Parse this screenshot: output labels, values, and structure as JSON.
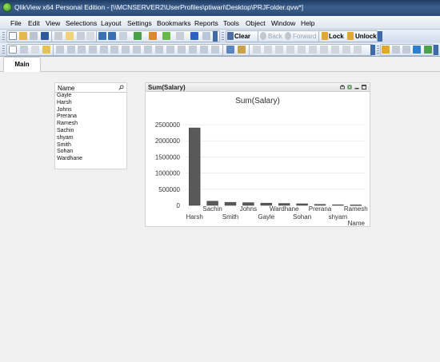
{
  "window": {
    "title": "QlikView x64 Personal Edition - [\\\\MCNSERVER2\\UserProfiles\\ptiwari\\Desktop\\PRJFolder.qvw*]"
  },
  "menu": [
    "File",
    "Edit",
    "View",
    "Selections",
    "Layout",
    "Settings",
    "Bookmarks",
    "Reports",
    "Tools",
    "Object",
    "Window",
    "Help"
  ],
  "toolbar": {
    "clear": "Clear",
    "back": "Back",
    "forward": "Forward",
    "lock": "Lock",
    "unlock": "Unlock"
  },
  "tabs": [
    {
      "label": "Main"
    }
  ],
  "listbox": {
    "title": "Name",
    "items": [
      "Gayle",
      "Harsh",
      "Johns",
      "Prerana",
      "Ramesh",
      "Sachin",
      "shyam",
      "Smith",
      "Sohan",
      "Wardhane"
    ]
  },
  "chartbox": {
    "caption": "Sum(Salary)",
    "chart_data": {
      "type": "bar",
      "title": "Sum(Salary)",
      "xlabel": "Name",
      "ylabel": "",
      "categories": [
        "Harsh",
        "Sachin",
        "Smith",
        "Johns",
        "Gayle",
        "Wardhane",
        "Sohan",
        "Prerana",
        "shyam",
        "Ramesh"
      ],
      "values": [
        2400000,
        130000,
        95000,
        85000,
        70000,
        60000,
        50000,
        30000,
        20000,
        15000
      ],
      "ylim": [
        0,
        2500000
      ],
      "yticks": [
        0,
        500000,
        1000000,
        1500000,
        2000000,
        2500000
      ],
      "grid": true,
      "bar_color": "#595959"
    }
  }
}
